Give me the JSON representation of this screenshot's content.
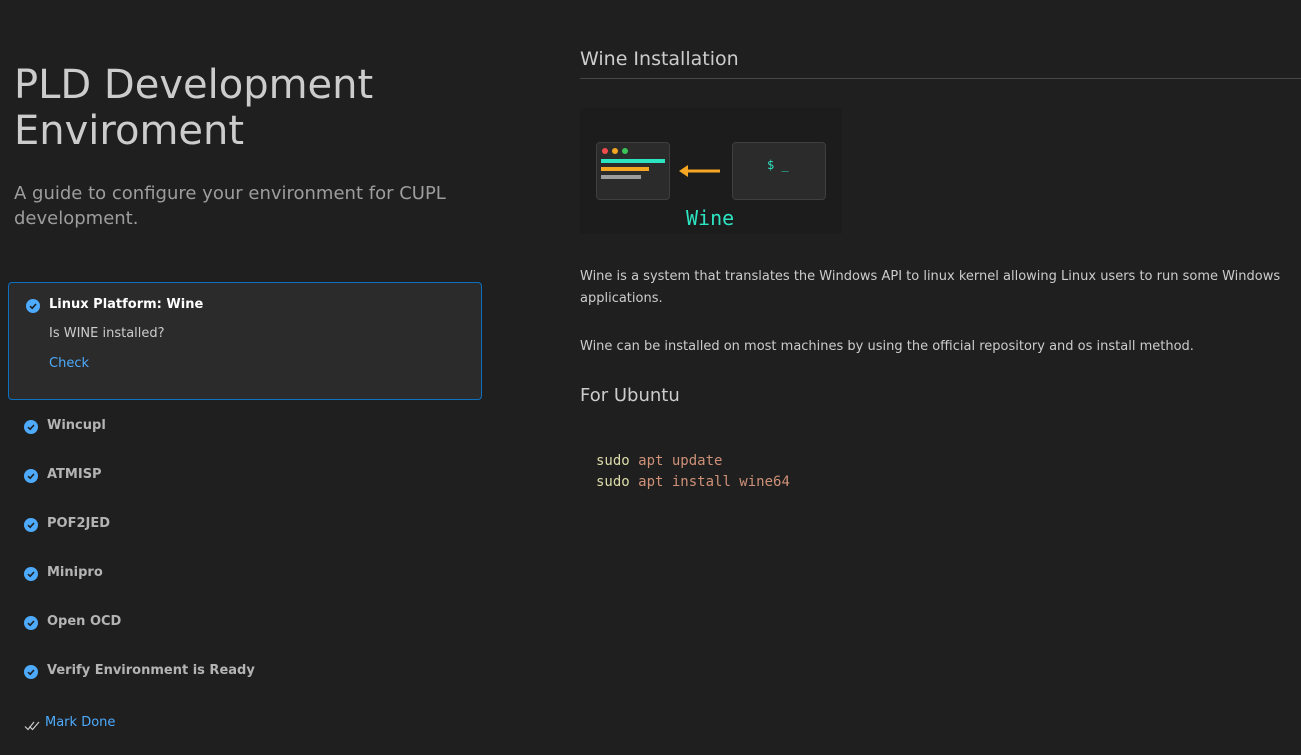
{
  "left": {
    "title": "PLD Development Enviroment",
    "subtitle": "A guide to configure your environment for CUPL development.",
    "active_step": {
      "title": "Linux Platform: Wine",
      "description": "Is WINE installed?",
      "link": "Check"
    },
    "steps": [
      {
        "title": "Wincupl"
      },
      {
        "title": "ATMISP"
      },
      {
        "title": "POF2JED"
      },
      {
        "title": "Minipro"
      },
      {
        "title": "Open OCD"
      },
      {
        "title": "Verify Environment is Ready"
      }
    ],
    "mark_done": "Mark Done"
  },
  "right": {
    "section_title": "Wine Installation",
    "illustration": {
      "prompt": "$ _",
      "label": "Wine"
    },
    "paragraphs": [
      "Wine is a system that translates the Windows API to linux kernel allowing Linux users to run some Windows applications.",
      "Wine can be installed on most machines by using the official repository and os install method."
    ],
    "sub_heading": "For Ubuntu",
    "code": [
      {
        "cmd": "sudo",
        "args": "apt update"
      },
      {
        "cmd": "sudo",
        "args": "apt install wine64"
      }
    ]
  },
  "colors": {
    "background": "#1f1f1f",
    "accent": "#4daafc",
    "active_border": "#0e70c0",
    "illustration_teal": "#2de4c1",
    "illustration_orange": "#f5a623"
  },
  "icons": {
    "step_status": "check-circle-icon",
    "mark_done": "double-check-icon"
  }
}
